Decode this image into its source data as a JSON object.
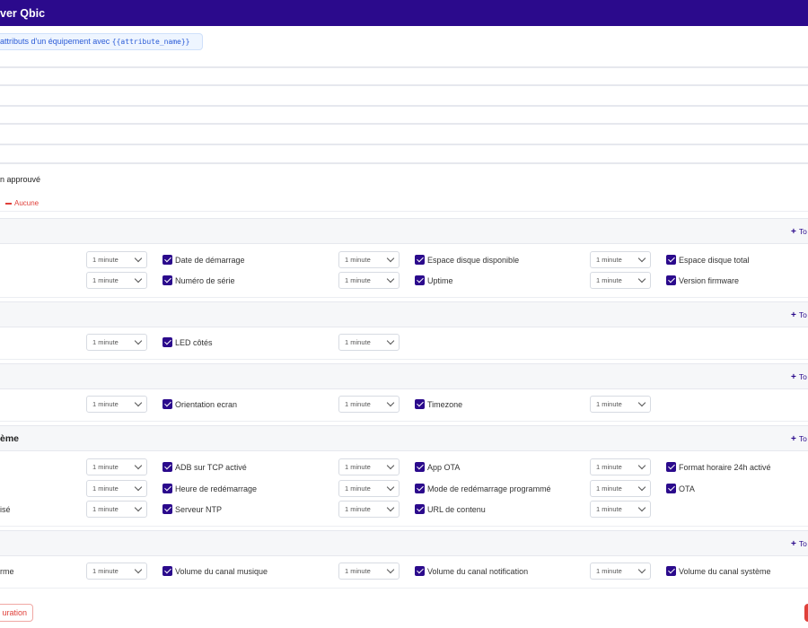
{
  "header": {
    "title": "ver Qbic"
  },
  "hint": {
    "text": "attributs d'un équipement avec ",
    "code": "{{attribute_name}}"
  },
  "approved_label": "n approuvé",
  "none_button": "Aucune",
  "toggle_all": "To",
  "interval_default": "1 minute",
  "sections": [
    {
      "title": "",
      "rows": [
        {
          "label": "",
          "items": [
            {
              "label": "Date de démarrage",
              "checked": true
            },
            {
              "label": "Espace disque disponible",
              "checked": true
            },
            {
              "label": "Espace disque total",
              "checked": true
            }
          ]
        },
        {
          "label": "",
          "items": [
            {
              "label": "Numéro de série",
              "checked": true
            },
            {
              "label": "Uptime",
              "checked": true
            },
            {
              "label": "Version firmware",
              "checked": true
            }
          ]
        }
      ]
    },
    {
      "title": "",
      "rows": [
        {
          "label": "",
          "items": [
            {
              "label": "LED côtés",
              "checked": true
            }
          ]
        }
      ]
    },
    {
      "title": "",
      "rows": [
        {
          "label": "",
          "items": [
            {
              "label": "Orientation ecran",
              "checked": true
            },
            {
              "label": "Timezone",
              "checked": true
            }
          ]
        }
      ]
    },
    {
      "title": "ème",
      "rows": [
        {
          "label": "",
          "items": [
            {
              "label": "ADB sur TCP activé",
              "checked": true
            },
            {
              "label": "App OTA",
              "checked": true
            },
            {
              "label": "Format horaire 24h activé",
              "checked": true
            }
          ]
        },
        {
          "label": "",
          "items": [
            {
              "label": "Heure de redémarrage",
              "checked": true
            },
            {
              "label": "Mode de redémarrage programmé",
              "checked": true
            },
            {
              "label": "OTA",
              "checked": true
            }
          ]
        },
        {
          "label": "isé",
          "items": [
            {
              "label": "Serveur NTP",
              "checked": true
            },
            {
              "label": "URL de contenu",
              "checked": true
            }
          ]
        }
      ]
    },
    {
      "title": "",
      "rows": [
        {
          "label": "rme",
          "items": [
            {
              "label": "Volume du canal musique",
              "checked": true
            },
            {
              "label": "Volume du canal notification",
              "checked": true
            },
            {
              "label": "Volume du canal système",
              "checked": true
            }
          ]
        }
      ]
    }
  ],
  "reset_button": "uration"
}
